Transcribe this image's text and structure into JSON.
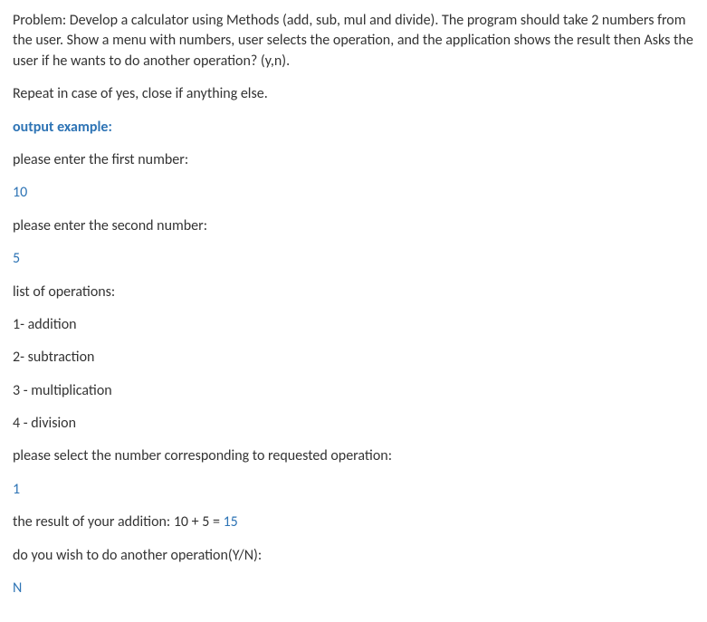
{
  "problem": {
    "description": "Problem: Develop a calculator using Methods (add, sub, mul and divide). The program should take 2 numbers from the user. Show a menu with numbers, user selects the operation, and the application shows the result then Asks the user if he wants to do another operation? (y,n).",
    "repeat_note": "Repeat in case of yes, close if anything else."
  },
  "output_label": "output example:",
  "prompts": {
    "first_number": "please enter the first number:",
    "second_number": "please enter the second number:",
    "operations_header": "list of operations:",
    "operations": [
      "1- addition",
      "2- subtraction",
      "3 - multiplication",
      "4 - division"
    ],
    "select_operation": "please select the number corresponding to requested operation:",
    "result_prefix": "the result of your addition:  10 + 5 = ",
    "result_value": "15",
    "do_another": "do you wish to do another operation(Y/N):"
  },
  "inputs": {
    "first_number": "10",
    "second_number": "5",
    "operation_choice": "1",
    "continue_choice": "N"
  }
}
